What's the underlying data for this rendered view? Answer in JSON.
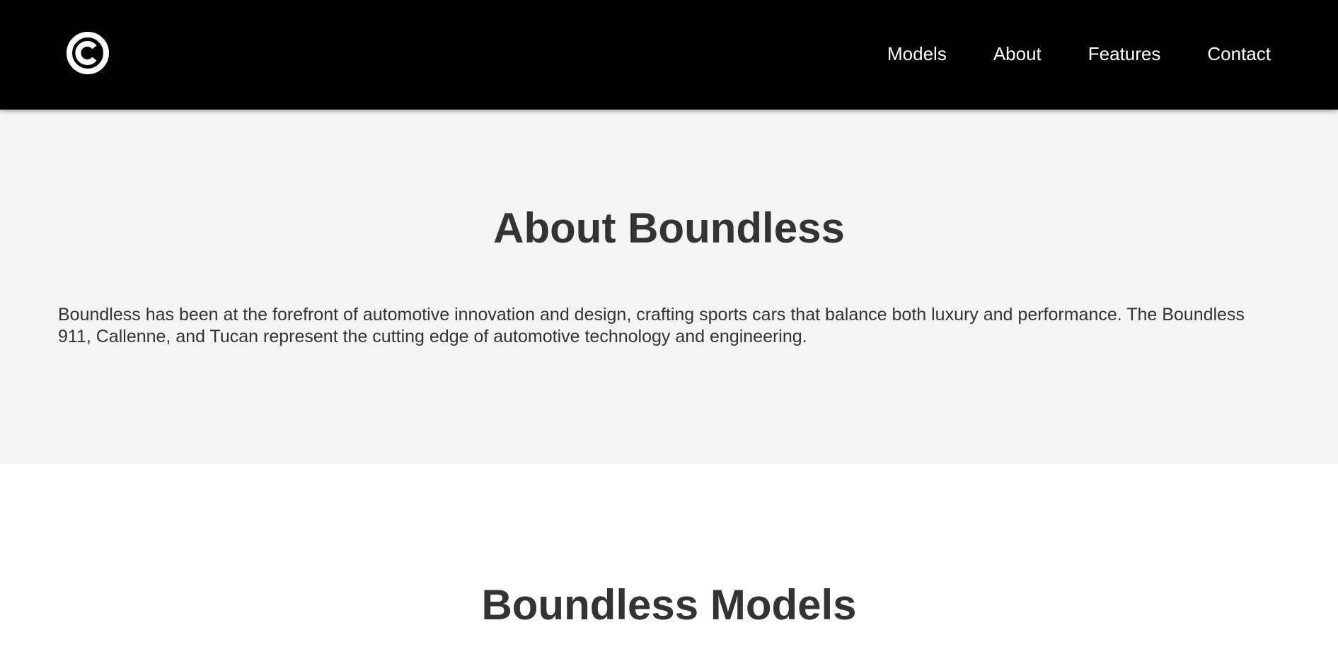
{
  "header": {
    "logo_icon": "copyright-style-c-logo-icon",
    "nav": [
      {
        "label": "Models"
      },
      {
        "label": "About"
      },
      {
        "label": "Features"
      },
      {
        "label": "Contact"
      }
    ]
  },
  "about": {
    "title": "About Boundless",
    "body": "Boundless has been at the forefront of automotive innovation and design, crafting sports cars that balance both luxury and performance. The Boundless 911, Callenne, and Tucan represent the cutting edge of automotive technology and engineering."
  },
  "models": {
    "title": "Boundless Models"
  },
  "colors": {
    "header_bg": "#000000",
    "nav_text": "#ffffff",
    "about_bg": "#f4f4f4",
    "heading_text": "#333333",
    "page_bg": "#ffffff"
  }
}
